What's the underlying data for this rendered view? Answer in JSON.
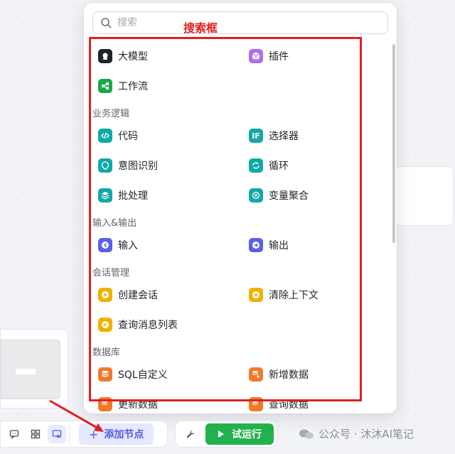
{
  "panel": {
    "search_placeholder": "搜索",
    "annotation_label": "搜索框",
    "items_top": [
      {
        "label": "大模型",
        "color": "#1f2329",
        "icon": "llm-icon"
      },
      {
        "label": "插件",
        "color": "#b36bf0",
        "icon": "plugin-cube-icon"
      },
      {
        "label": "工作流",
        "color": "#18a84a",
        "icon": "workflow-icon"
      }
    ],
    "sections": [
      {
        "title": "业务逻辑",
        "items": [
          {
            "label": "代码",
            "color": "#11a9a8",
            "icon": "code-icon"
          },
          {
            "label": "选择器",
            "color": "#11a9a8",
            "icon": "if-icon",
            "icon_text": "IF"
          },
          {
            "label": "意图识别",
            "color": "#11a9a8",
            "icon": "intent-icon"
          },
          {
            "label": "循环",
            "color": "#11a9a8",
            "icon": "loop-icon"
          },
          {
            "label": "批处理",
            "color": "#11a9a8",
            "icon": "batch-icon"
          },
          {
            "label": "变量聚合",
            "color": "#11a9a8",
            "icon": "variable-merge-icon"
          }
        ]
      },
      {
        "title": "输入&输出",
        "items": [
          {
            "label": "输入",
            "color": "#5b5fe8",
            "icon": "input-icon"
          },
          {
            "label": "输出",
            "color": "#5b5fe8",
            "icon": "output-icon"
          }
        ]
      },
      {
        "title": "会话管理",
        "items": [
          {
            "label": "创建会话",
            "color": "#f0b100",
            "icon": "create-conversation-icon"
          },
          {
            "label": "清除上下文",
            "color": "#f0b100",
            "icon": "clear-context-icon"
          },
          {
            "label": "查询消息列表",
            "color": "#f0b100",
            "icon": "message-list-icon"
          }
        ]
      },
      {
        "title": "数据库",
        "items": [
          {
            "label": "SQL自定义",
            "color": "#f07a2a",
            "icon": "sql-icon"
          },
          {
            "label": "新增数据",
            "color": "#f07a2a",
            "icon": "add-data-icon"
          },
          {
            "label": "更新数据",
            "color": "#f07a2a",
            "icon": "update-data-icon"
          },
          {
            "label": "查询数据",
            "color": "#f07a2a",
            "icon": "query-data-icon"
          }
        ]
      }
    ]
  },
  "toolbar": {
    "add_node_label": "添加节点",
    "run_label": "试运行"
  },
  "watermark": "公众号 · 沐沐AI笔记",
  "colors": {
    "accent": "#4e5ae8",
    "run": "#22b14c",
    "annotation": "#e02020"
  }
}
